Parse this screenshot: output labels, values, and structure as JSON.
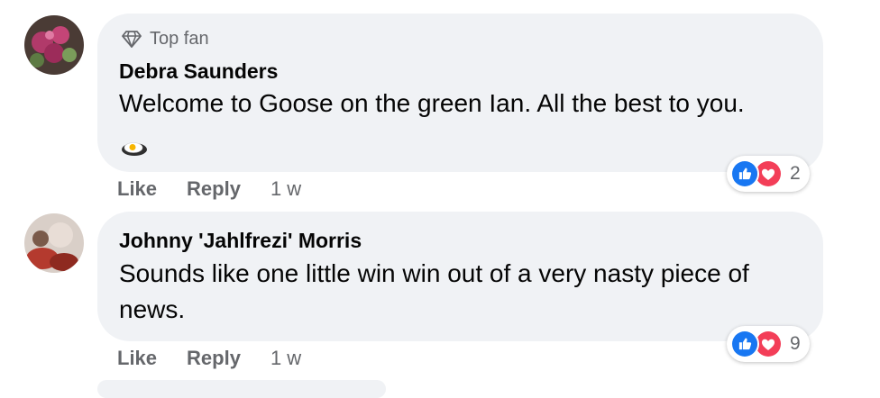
{
  "comments": [
    {
      "badge": "Top fan",
      "author": "Debra Saunders",
      "text": "Welcome to Goose on the green Ian. All the best to you.",
      "actions": {
        "like": "Like",
        "reply": "Reply",
        "time": "1 w"
      },
      "reaction_count": "2"
    },
    {
      "author": "Johnny 'Jahlfrezi' Morris",
      "text": "Sounds like one little win win out of a very nasty piece of news.",
      "actions": {
        "like": "Like",
        "reply": "Reply",
        "time": "1 w"
      },
      "reaction_count": "9"
    }
  ],
  "icons": {
    "badge": "diamond-icon",
    "emoji": "fried-egg-emoji-icon",
    "reaction_like": "like-reaction-icon",
    "reaction_love": "love-reaction-icon"
  },
  "colors": {
    "bubble": "#f0f2f5",
    "secondary_text": "#65676b",
    "like_blue": "#1877f2",
    "love_red": "#f33e58"
  }
}
